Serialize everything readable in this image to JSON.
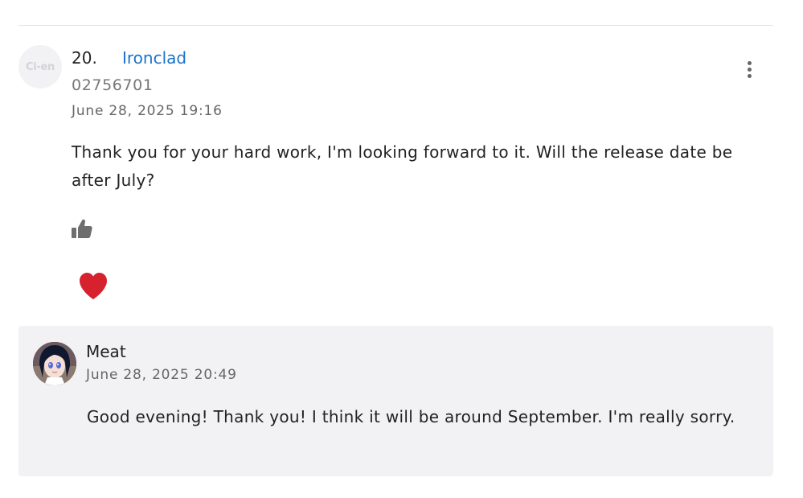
{
  "divider": true,
  "comment": {
    "avatar_text": "Ci-en",
    "number": "20.",
    "author": "Ironclad",
    "user_id": "02756701",
    "date": "June 28, 2025 19:16",
    "body": "Thank you for your hard work, I'm looking forward to it. Will the release date be after July?",
    "more_icon": "kebab-menu-icon",
    "like_icon": "thumbs-up-icon",
    "reaction_icon": "heart-icon",
    "colors": {
      "author_link": "#1a73c7",
      "heart": "#d6212e",
      "like": "#6e6e6e"
    }
  },
  "reply": {
    "name": "Meat",
    "date": "June 28, 2025 20:49",
    "body": "Good evening! Thank you! I think it will be around September. I'm really sorry.",
    "background": "#f2f1f4"
  }
}
